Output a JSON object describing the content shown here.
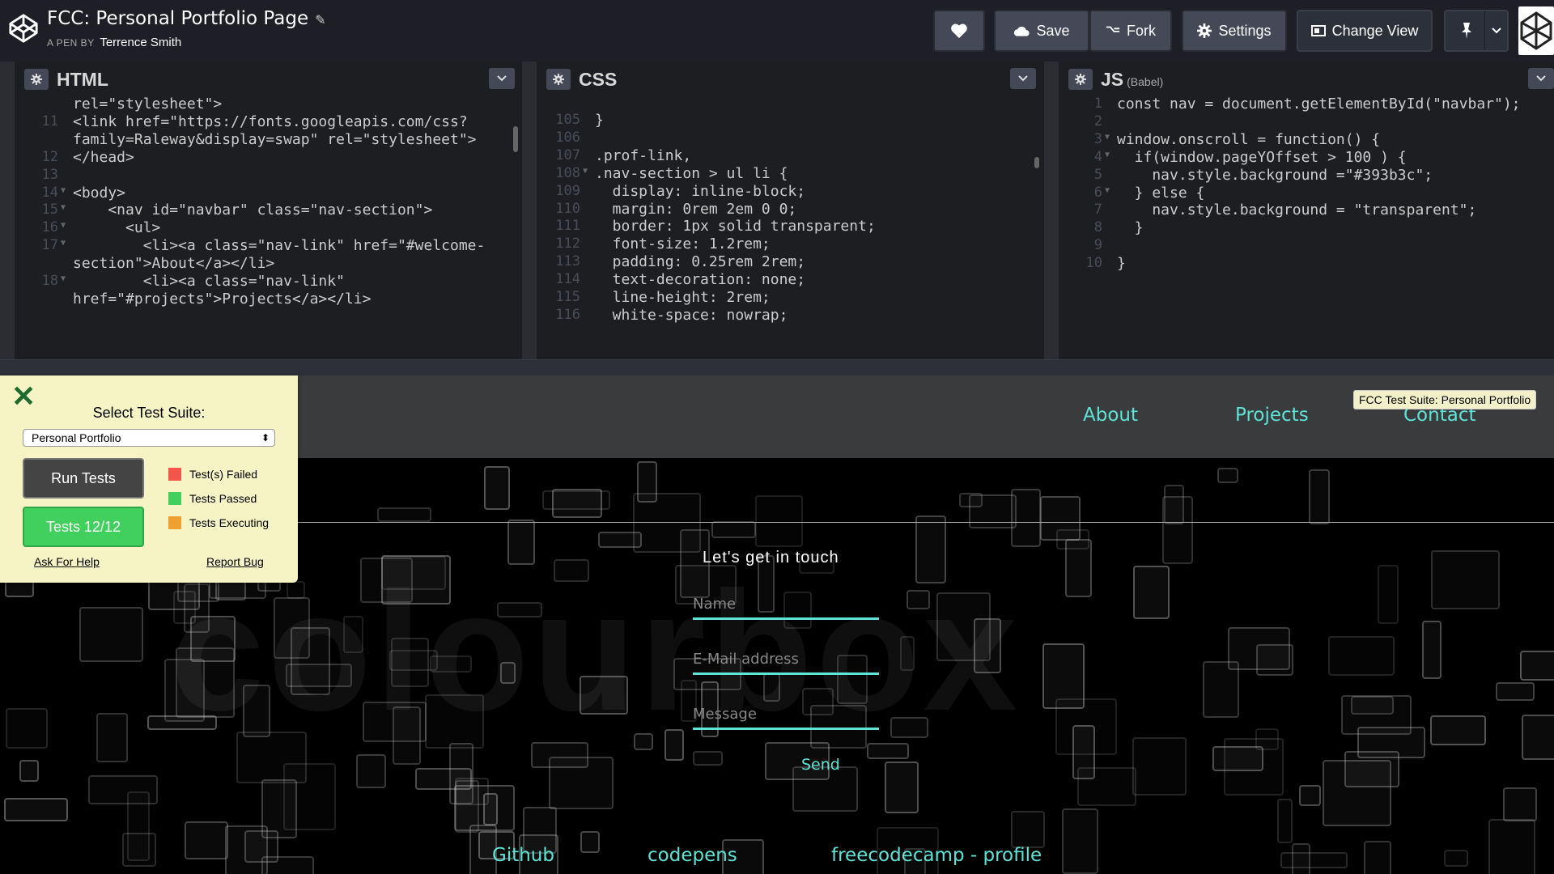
{
  "header": {
    "title": "FCC: Personal Portfolio Page",
    "by_label": "A PEN BY",
    "author": "Terrence Smith",
    "buttons": {
      "save": "Save",
      "fork": "Fork",
      "settings": "Settings",
      "change_view": "Change View"
    }
  },
  "editors": {
    "html": {
      "label": "HTML",
      "lines": [
        {
          "n": "",
          "fold": false,
          "text": "rel=\"stylesheet\">"
        },
        {
          "n": "11",
          "fold": false,
          "text": "<link href=\"https://fonts.googleapis.com/css?"
        },
        {
          "n": "",
          "fold": false,
          "text": "family=Raleway&display=swap\" rel=\"stylesheet\">"
        },
        {
          "n": "12",
          "fold": false,
          "text": "</head>"
        },
        {
          "n": "13",
          "fold": false,
          "text": ""
        },
        {
          "n": "14",
          "fold": true,
          "text": "<body>"
        },
        {
          "n": "15",
          "fold": true,
          "text": "    <nav id=\"navbar\" class=\"nav-section\">"
        },
        {
          "n": "16",
          "fold": true,
          "text": "      <ul>"
        },
        {
          "n": "17",
          "fold": true,
          "text": "        <li><a class=\"nav-link\" href=\"#welcome-"
        },
        {
          "n": "",
          "fold": false,
          "text": "section\">About</a></li>"
        },
        {
          "n": "18",
          "fold": true,
          "text": "        <li><a class=\"nav-link\""
        },
        {
          "n": "",
          "fold": false,
          "text": "href=\"#projects\">Projects</a></li>"
        }
      ]
    },
    "css": {
      "label": "CSS",
      "lines": [
        {
          "n": "105",
          "fold": false,
          "text": "}"
        },
        {
          "n": "106",
          "fold": false,
          "text": ""
        },
        {
          "n": "107",
          "fold": false,
          "text": ".prof-link,"
        },
        {
          "n": "108",
          "fold": true,
          "text": ".nav-section > ul li {"
        },
        {
          "n": "109",
          "fold": false,
          "text": "  display: inline-block;"
        },
        {
          "n": "110",
          "fold": false,
          "text": "  margin: 0rem 2em 0 0;"
        },
        {
          "n": "111",
          "fold": false,
          "text": "  border: 1px solid transparent;"
        },
        {
          "n": "112",
          "fold": false,
          "text": "  font-size: 1.2rem;"
        },
        {
          "n": "113",
          "fold": false,
          "text": "  padding: 0.25rem 2rem;"
        },
        {
          "n": "114",
          "fold": false,
          "text": "  text-decoration: none;"
        },
        {
          "n": "115",
          "fold": false,
          "text": "  line-height: 2rem;"
        },
        {
          "n": "116",
          "fold": false,
          "text": "  white-space: nowrap;"
        }
      ]
    },
    "js": {
      "label": "JS",
      "sublabel": "(Babel)",
      "lines": [
        {
          "n": "1",
          "fold": false,
          "text": "const nav = document.getElementById(\"navbar\");"
        },
        {
          "n": "2",
          "fold": false,
          "text": ""
        },
        {
          "n": "3",
          "fold": true,
          "text": "window.onscroll = function() {"
        },
        {
          "n": "4",
          "fold": true,
          "text": "  if(window.pageYOffset > 100 ) {"
        },
        {
          "n": "5",
          "fold": false,
          "text": "    nav.style.background =\"#393b3c\";"
        },
        {
          "n": "6",
          "fold": true,
          "text": "  } else {"
        },
        {
          "n": "7",
          "fold": false,
          "text": "    nav.style.background = \"transparent\";"
        },
        {
          "n": "8",
          "fold": false,
          "text": "  }"
        },
        {
          "n": "9",
          "fold": false,
          "text": ""
        },
        {
          "n": "10",
          "fold": false,
          "text": "}"
        }
      ]
    }
  },
  "preview": {
    "nav": {
      "about": "About",
      "projects": "Projects",
      "contact": "Contact"
    },
    "suite_tag": "FCC Test Suite: Personal Portfolio",
    "watermark": "colourbox",
    "contact": {
      "title": "Let's get in touch",
      "name_placeholder": "Name",
      "email_placeholder": "E-Mail address",
      "message_placeholder": "Message",
      "send": "Send"
    },
    "footer": {
      "github": "Github",
      "codepens": "codepens",
      "fcc_profile": "freecodecamp - profile"
    }
  },
  "fcc_panel": {
    "select_label": "Select Test Suite:",
    "selected_suite": "Personal Portfolio",
    "run_tests": "Run Tests",
    "tests_status": "Tests 12/12",
    "legend": {
      "failed": "Test(s) Failed",
      "passed": "Tests Passed",
      "executing": "Tests Executing"
    },
    "ask_help": "Ask For Help",
    "report_bug": "Report Bug"
  },
  "colors": {
    "accent_teal": "#5fe3d7",
    "nav_bg": "#393b3c",
    "failed": "#f2564a",
    "passed": "#41d05e",
    "executing": "#f0a030",
    "panel_bg": "#f6f3c5"
  }
}
